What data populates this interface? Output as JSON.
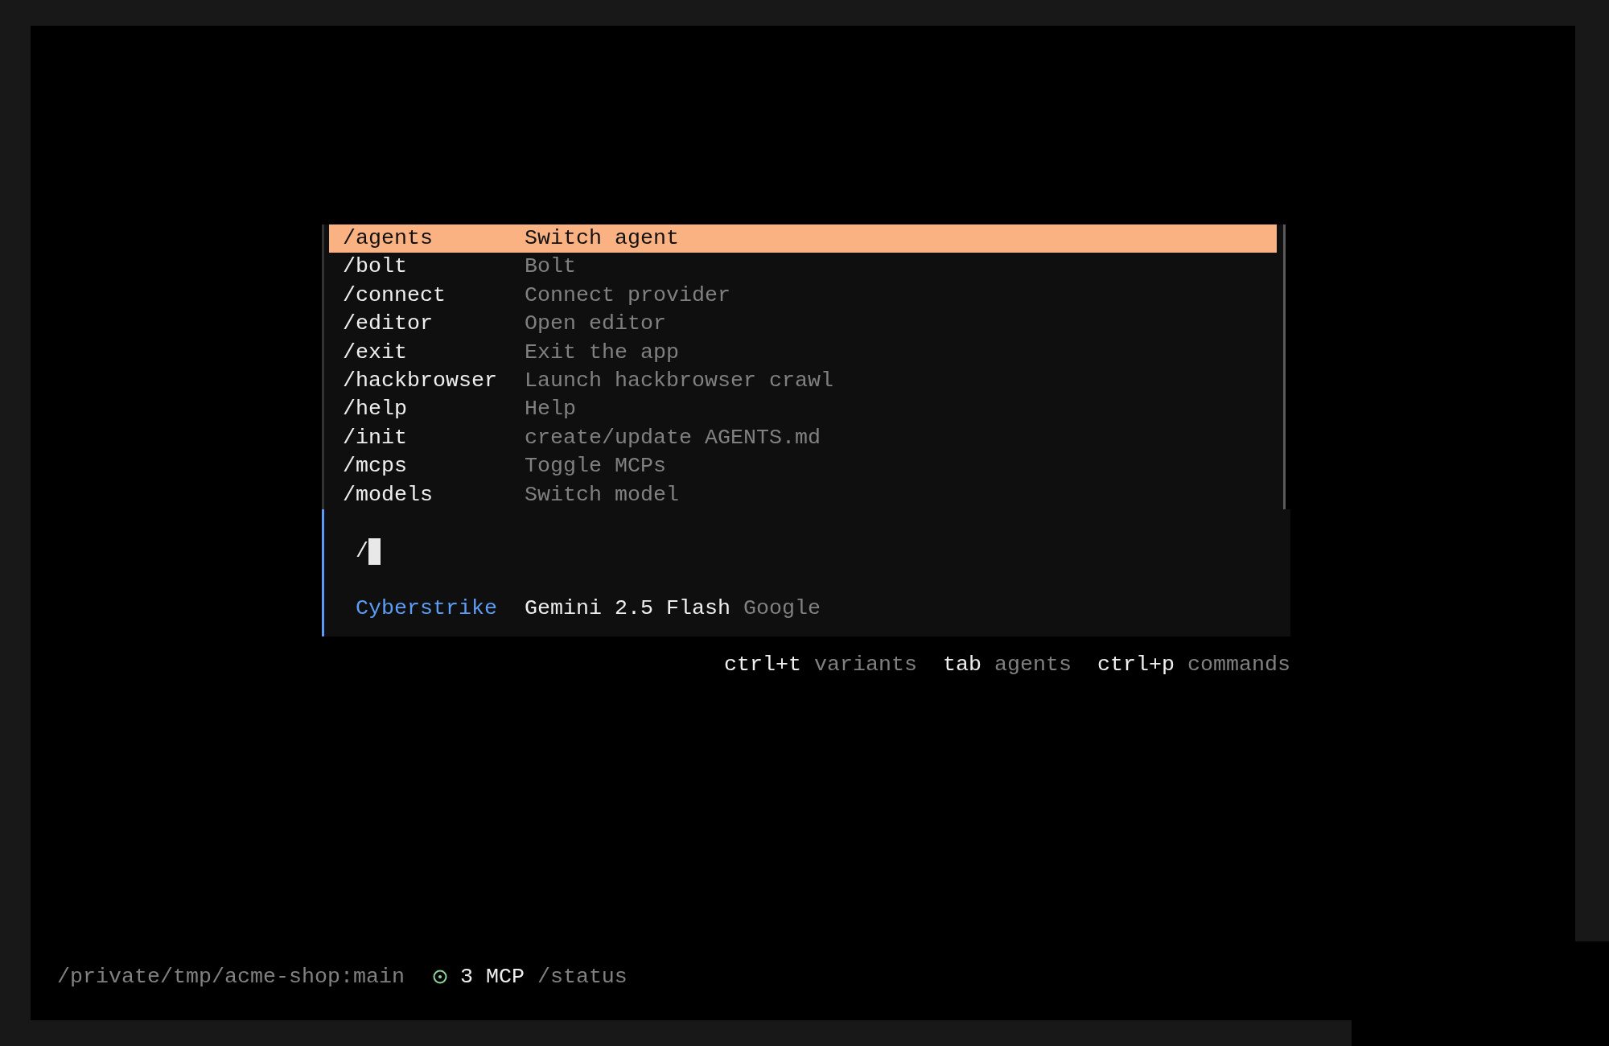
{
  "commands": [
    {
      "command": "/agents",
      "description": "Switch agent",
      "selected": true
    },
    {
      "command": "/bolt",
      "description": "Bolt",
      "selected": false
    },
    {
      "command": "/connect",
      "description": "Connect provider",
      "selected": false
    },
    {
      "command": "/editor",
      "description": "Open editor",
      "selected": false
    },
    {
      "command": "/exit",
      "description": "Exit the app",
      "selected": false
    },
    {
      "command": "/hackbrowser",
      "description": "Launch hackbrowser crawl",
      "selected": false
    },
    {
      "command": "/help",
      "description": "Help",
      "selected": false
    },
    {
      "command": "/init",
      "description": "create/update AGENTS.md",
      "selected": false
    },
    {
      "command": "/mcps",
      "description": "Toggle MCPs",
      "selected": false
    },
    {
      "command": "/models",
      "description": "Switch model",
      "selected": false
    }
  ],
  "prompt": {
    "value": "/",
    "agent": "Cyberstrike",
    "model": "Gemini 2.5 Flash",
    "provider": "Google"
  },
  "shortcuts": [
    {
      "key": "ctrl+t",
      "label": "variants"
    },
    {
      "key": "tab",
      "label": "agents"
    },
    {
      "key": "ctrl+p",
      "label": "commands"
    }
  ],
  "status_bar": {
    "path": "/private/tmp/acme-shop:main",
    "mcp": "3 MCP",
    "command": "/status"
  }
}
